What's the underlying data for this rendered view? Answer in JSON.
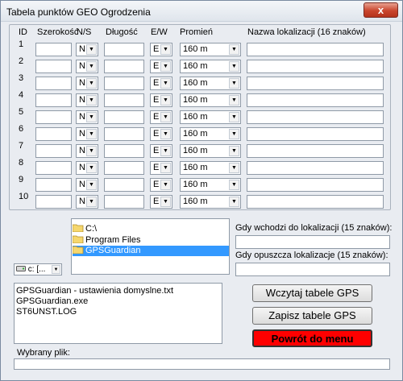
{
  "window": {
    "title": "Tabela punktów GEO Ogrodzenia",
    "close_symbol": "x"
  },
  "table": {
    "headers": {
      "id": "ID",
      "latitude": "Szerokość",
      "ns": "N/S",
      "longitude": "Długość",
      "ew": "E/W",
      "radius": "Promień",
      "name": "Nazwa lokalizacji (16 znaków)"
    },
    "rows": [
      {
        "id": "1",
        "latitude": "",
        "ns": "N",
        "longitude": "",
        "ew": "E",
        "radius": "160 m",
        "name": ""
      },
      {
        "id": "2",
        "latitude": "",
        "ns": "N",
        "longitude": "",
        "ew": "E",
        "radius": "160 m",
        "name": ""
      },
      {
        "id": "3",
        "latitude": "",
        "ns": "N",
        "longitude": "",
        "ew": "E",
        "radius": "160 m",
        "name": ""
      },
      {
        "id": "4",
        "latitude": "",
        "ns": "N",
        "longitude": "",
        "ew": "E",
        "radius": "160 m",
        "name": ""
      },
      {
        "id": "5",
        "latitude": "",
        "ns": "N",
        "longitude": "",
        "ew": "E",
        "radius": "160 m",
        "name": ""
      },
      {
        "id": "6",
        "latitude": "",
        "ns": "N",
        "longitude": "",
        "ew": "E",
        "radius": "160 m",
        "name": ""
      },
      {
        "id": "7",
        "latitude": "",
        "ns": "N",
        "longitude": "",
        "ew": "E",
        "radius": "160 m",
        "name": ""
      },
      {
        "id": "8",
        "latitude": "",
        "ns": "N",
        "longitude": "",
        "ew": "E",
        "radius": "160 m",
        "name": ""
      },
      {
        "id": "9",
        "latitude": "",
        "ns": "N",
        "longitude": "",
        "ew": "E",
        "radius": "160 m",
        "name": ""
      },
      {
        "id": "10",
        "latitude": "",
        "ns": "N",
        "longitude": "",
        "ew": "E",
        "radius": "160 m",
        "name": ""
      }
    ]
  },
  "directories": [
    {
      "name": "C:\\",
      "selected": false
    },
    {
      "name": "Program Files",
      "selected": false
    },
    {
      "name": "GPSGuardian",
      "selected": true
    }
  ],
  "drive": {
    "value": "c: [...",
    "icon": "drive-icon"
  },
  "enter_label": "Gdy wchodzi do lokalizacji (15 znaków):",
  "enter_value": "",
  "exit_label": "Gdy opuszcza lokalizacje (15 znaków):",
  "exit_value": "",
  "files": [
    "GPSGuardian - ustawienia domyslne.txt",
    "GPSGuardian.exe",
    "ST6UNST.LOG"
  ],
  "buttons": {
    "load": "Wczytaj tabele GPS",
    "save": "Zapisz tabele GPS",
    "back": "Powrót do menu"
  },
  "selected_file_label": "Wybrany plik:",
  "selected_file_value": "",
  "colors": {
    "back_button": "#ff0000",
    "selection": "#3399ff",
    "folder": "#f5d76e"
  }
}
